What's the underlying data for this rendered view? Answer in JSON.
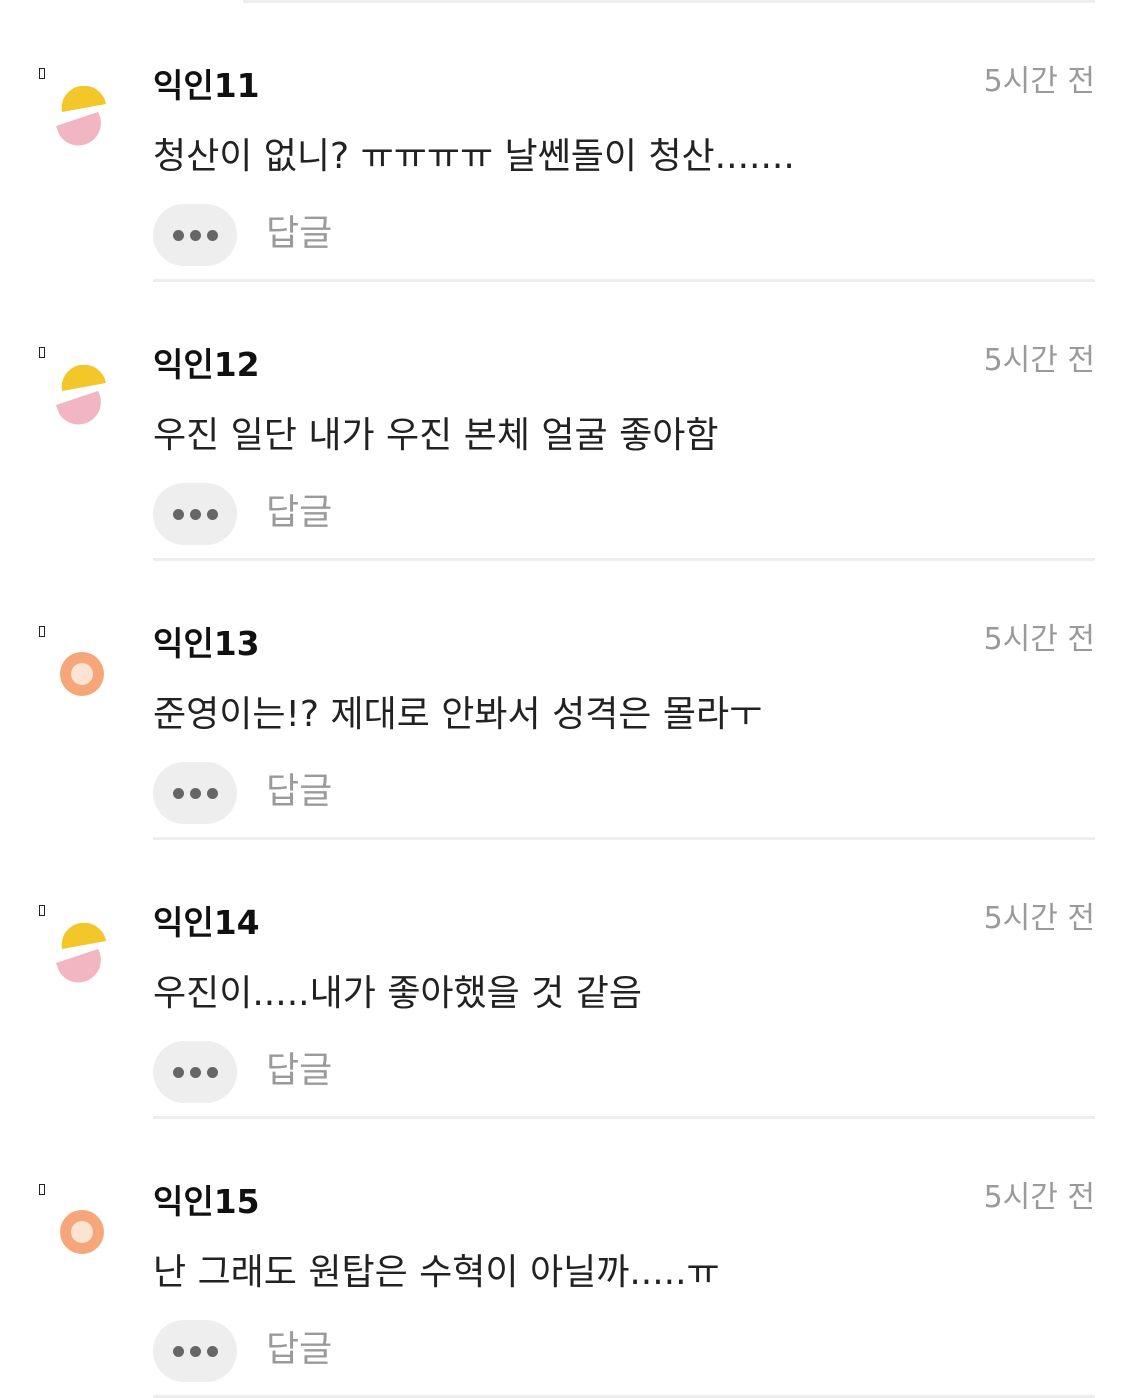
{
  "comments": [
    {
      "nickname": "익인11",
      "time": "5시간 전",
      "text": "청산이 없니? ㅠㅠㅠㅠ 날쎈돌이 청산.......",
      "avatar": "yellow-pink-icon",
      "reply_label": "답글"
    },
    {
      "nickname": "익인12",
      "time": "5시간 전",
      "text": "우진 일단 내가 우진 본체 얼굴 좋아함",
      "avatar": "yellow-pink-icon",
      "reply_label": "답글"
    },
    {
      "nickname": "익인13",
      "time": "5시간 전",
      "text": "준영이는!? 제대로 안봐서 성격은 몰라ㅜ",
      "avatar": "orange-ring-icon",
      "reply_label": "답글"
    },
    {
      "nickname": "익인14",
      "time": "5시간 전",
      "text": "우진이.....내가 좋아했을 것 같음",
      "avatar": "yellow-pink-icon",
      "reply_label": "답글"
    },
    {
      "nickname": "익인15",
      "time": "5시간 전",
      "text": "난 그래도 원탑은 수혁이 아닐까.....ㅠ",
      "avatar": "orange-ring-icon",
      "reply_label": "답글"
    }
  ],
  "colors": {
    "avatar_yellow": "#f3c62a",
    "avatar_pink": "#f2b6c3",
    "avatar_orange": "#f5a77a",
    "divider": "#eeeeee",
    "muted_text": "#9a9a9a"
  }
}
